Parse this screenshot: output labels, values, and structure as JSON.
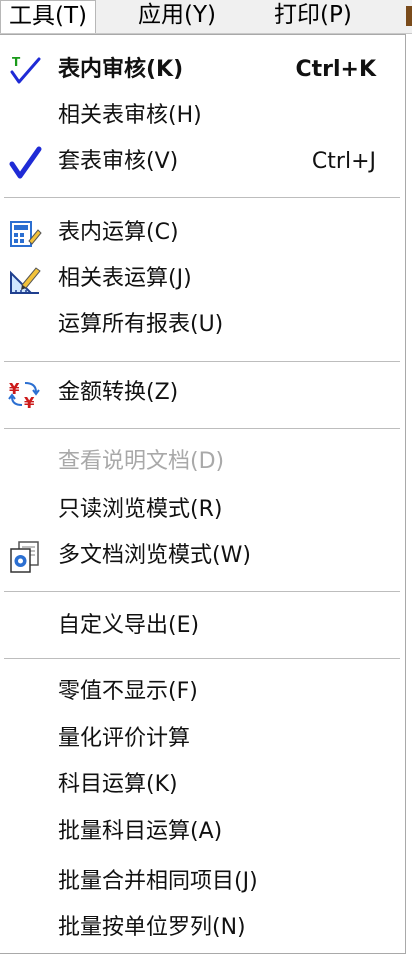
{
  "menubar": {
    "tools": "工具(T)",
    "apply": "应用(Y)",
    "print": "打印(P)"
  },
  "menu": {
    "intra_check": {
      "label": "表内审核(K)",
      "shortcut": "Ctrl+K",
      "checked": true
    },
    "related_check": {
      "label": "相关表审核(H)"
    },
    "set_check": {
      "label": "套表审核(V)",
      "shortcut": "Ctrl+J",
      "checked": true
    },
    "intra_calc": {
      "label": "表内运算(C)"
    },
    "related_calc": {
      "label": "相关表运算(J)"
    },
    "calc_all": {
      "label": "运算所有报表(U)"
    },
    "amount_convert": {
      "label": "金额转换(Z)"
    },
    "view_docs": {
      "label": "查看说明文档(D)",
      "disabled": true
    },
    "readonly_mode": {
      "label": "只读浏览模式(R)"
    },
    "multidoc_mode": {
      "label": "多文档浏览模式(W)"
    },
    "custom_export": {
      "label": "自定义导出(E)"
    },
    "hide_zero": {
      "label": "零值不显示(F)"
    },
    "quant_eval": {
      "label": "量化评价计算"
    },
    "subject_calc": {
      "label": "科目运算(K)"
    },
    "batch_subject_calc": {
      "label": "批量科目运算(A)"
    },
    "batch_merge": {
      "label": "批量合并相同项目(J)"
    },
    "batch_arrange": {
      "label": "批量按单位罗列(N)"
    }
  },
  "icons": {
    "check": "checkmark-icon",
    "calc": "calculator-edit-icon",
    "ruler": "ruler-pencil-icon",
    "currency": "currency-convert-icon",
    "docs": "multi-document-icon"
  },
  "colors": {
    "check_blue": "#1f2bd6",
    "check_green": "#1a9a1a",
    "icon_blue": "#2b6fd1",
    "currency_red": "#cc1a1a"
  }
}
